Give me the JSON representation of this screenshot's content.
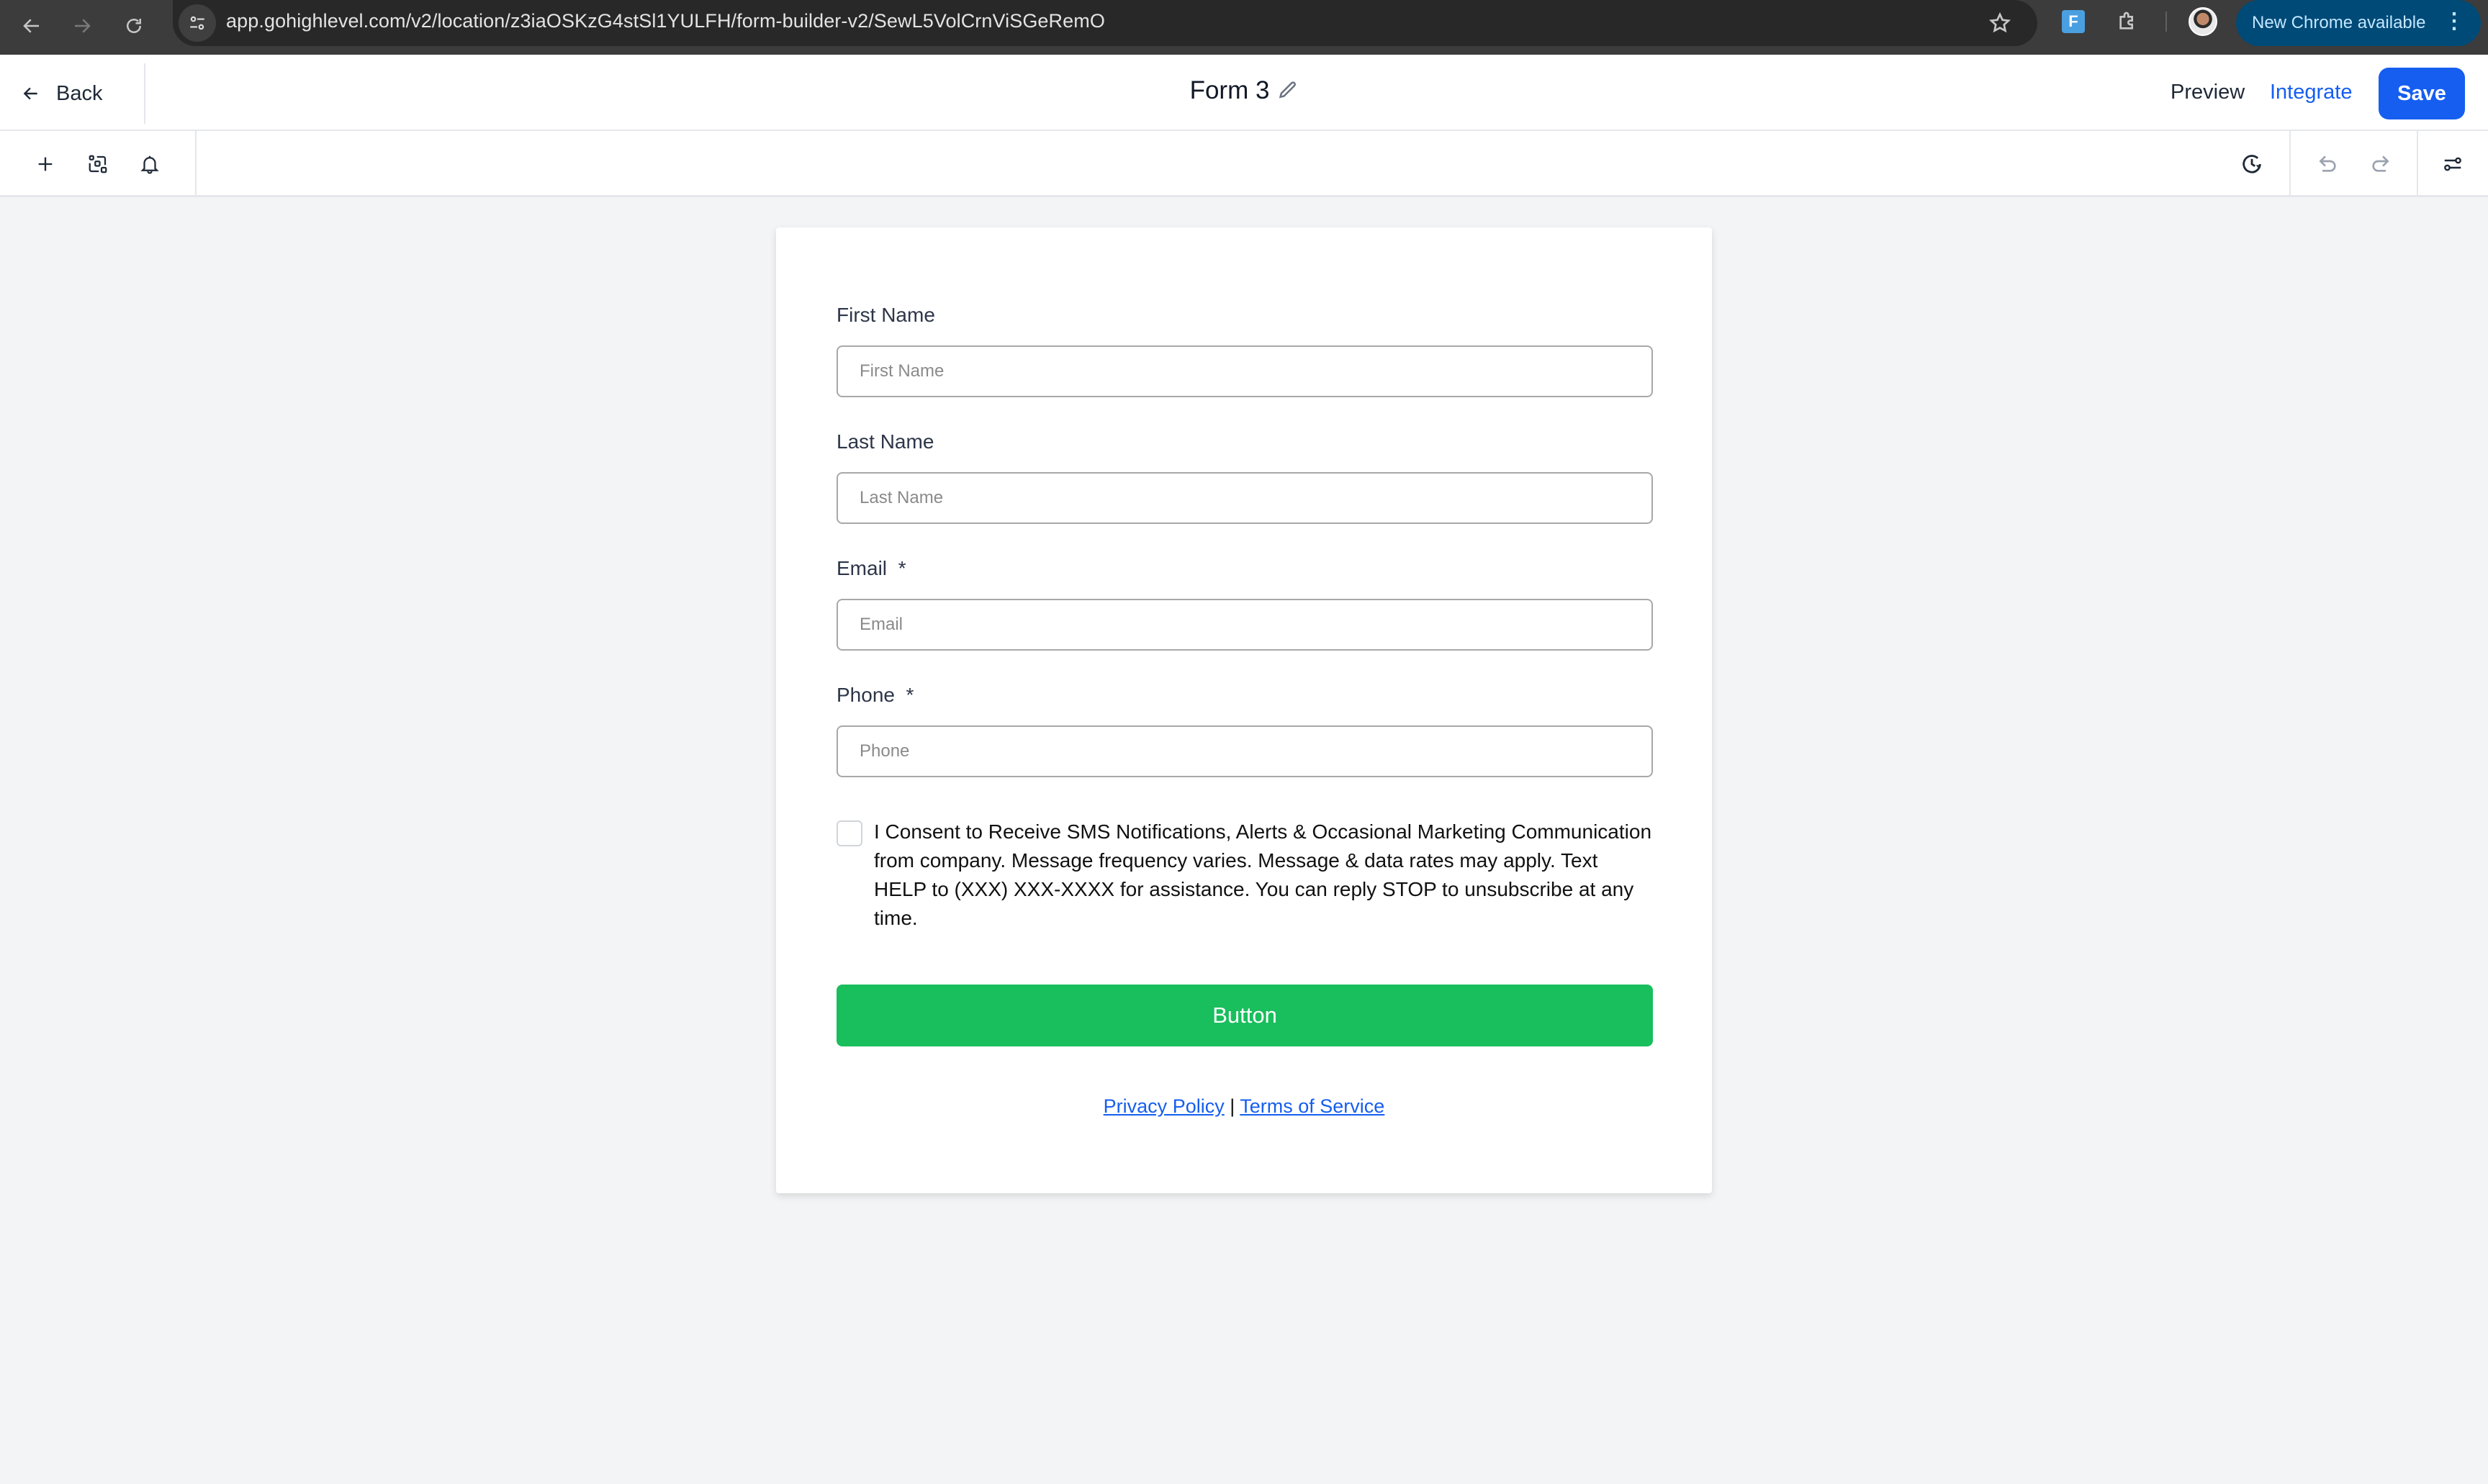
{
  "browser": {
    "url": "app.gohighlevel.com/v2/location/z3iaOSKzG4stSl1YULFH/form-builder-v2/SewL5VolCrnViSGeRemO",
    "extension_label": "F",
    "update_badge": "New Chrome available",
    "icons": [
      "back-arrow-icon",
      "forward-arrow-icon",
      "reload-icon",
      "site-info-icon",
      "bookmark-star-icon",
      "extension-icon",
      "puzzle-icon",
      "profile-avatar",
      "more-vert-icon"
    ]
  },
  "header": {
    "back_label": "Back",
    "form_title": "Form 3",
    "preview_label": "Preview",
    "integrate_label": "Integrate",
    "save_label": "Save"
  },
  "toolbar": {
    "left_icons": [
      "add-icon",
      "layout-elements-icon",
      "bell-icon"
    ],
    "right_icons": [
      "history-icon",
      "undo-icon",
      "redo-icon",
      "settings-sliders-icon"
    ]
  },
  "form": {
    "fields": [
      {
        "label": "First Name",
        "required": false,
        "placeholder": "First Name",
        "value": ""
      },
      {
        "label": "Last Name",
        "required": false,
        "placeholder": "Last Name",
        "value": ""
      },
      {
        "label": "Email",
        "required": true,
        "placeholder": "Email",
        "value": ""
      },
      {
        "label": "Phone",
        "required": true,
        "placeholder": "Phone",
        "value": ""
      }
    ],
    "required_marker": "*",
    "consent": {
      "checked": false,
      "text": "I Consent to Receive SMS Notifications, Alerts & Occasional Marketing Communication from company. Message frequency varies. Message & data rates may apply. Text HELP to (XXX) XXX-XXXX for assistance. You can reply STOP to unsubscribe at any time."
    },
    "submit_label": "Button",
    "privacy_label": "Privacy Policy",
    "separator": "|",
    "terms_label": "Terms of Service"
  },
  "colors": {
    "primary": "#155eef",
    "submit": "#19be5d",
    "canvas_bg": "#f3f4f6",
    "chrome_update": "#004a77"
  }
}
